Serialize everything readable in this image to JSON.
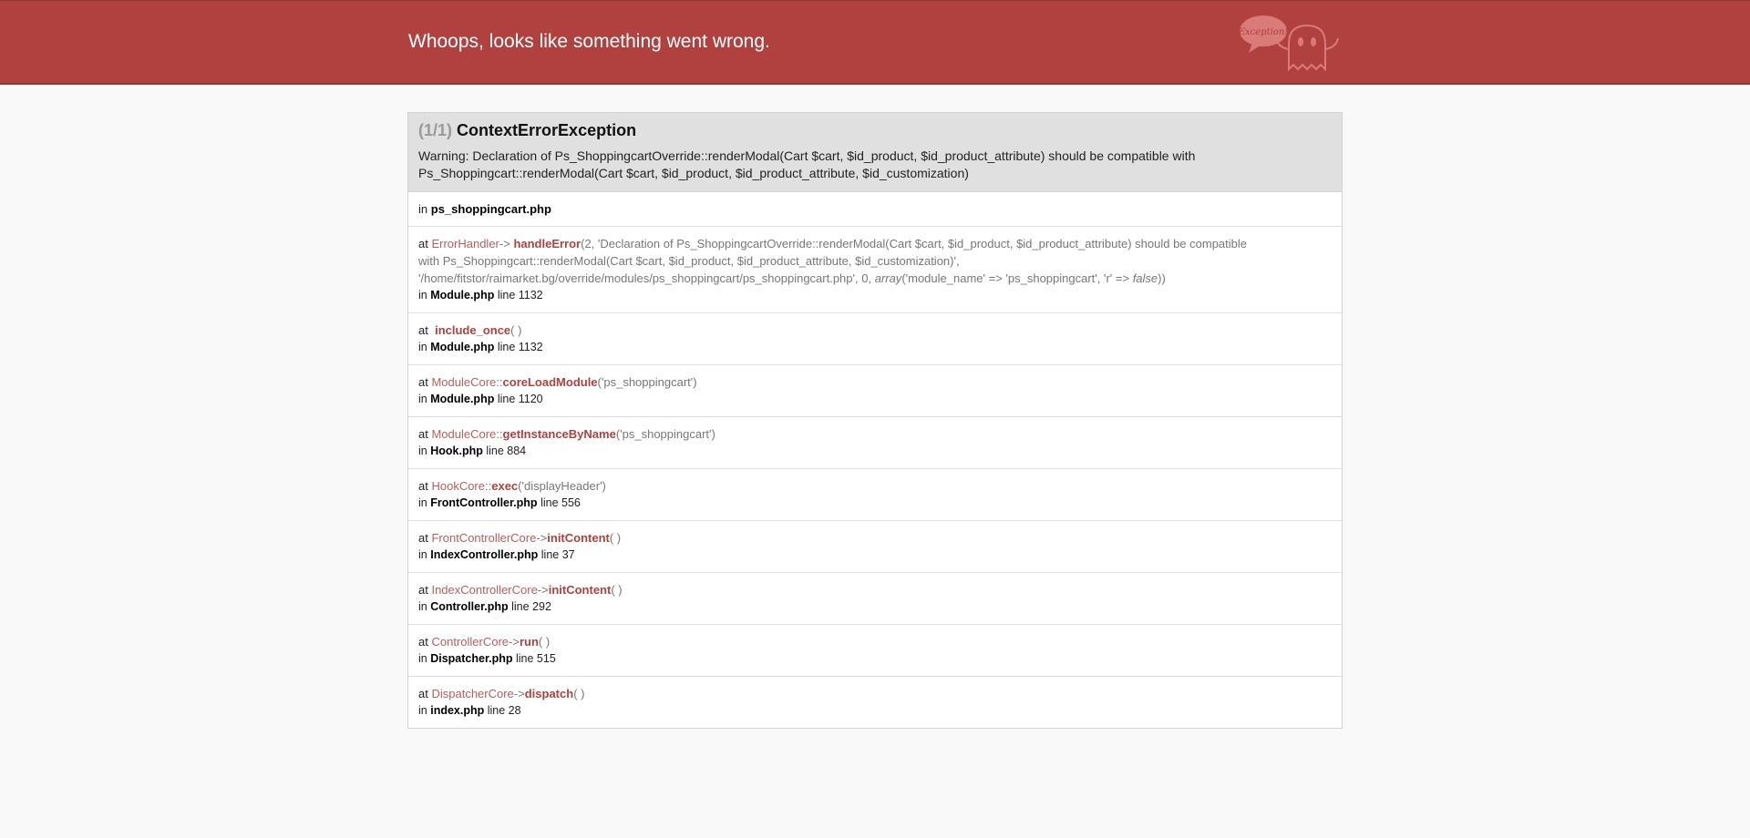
{
  "header": {
    "title": "Whoops, looks like something went wrong.",
    "logo_icon": "ghost-exception-icon",
    "logo_text": "Exception!"
  },
  "exception": {
    "count": "(1/1)",
    "name": "ContextErrorException",
    "message_line1": "Warning: Declaration of Ps_ShoppingcartOverride::renderModal(Cart $cart, $id_product, $id_product_attribute) should be compatible with",
    "message_line2": "Ps_Shoppingcart::renderModal(Cart $cart, $id_product, $id_product_attribute, $id_customization)"
  },
  "trace": {
    "first_file": "ps_shoppingcart.php",
    "frames": [
      {
        "class": "ErrorHandler",
        "sep": "->",
        "method": "handleError",
        "args_line1": "(2, 'Declaration of Ps_ShoppingcartOverride::renderModal(Cart $cart, $id_product, $id_product_attribute) should be compatible",
        "args_line2": "with Ps_Shoppingcart::renderModal(Cart $cart, $id_product, $id_product_attribute, $id_customization)',",
        "args_line3a": "'/home/fitstor/raimarket.bg/override/modules/ps_shoppingcart/ps_shoppingcart.php', 0, ",
        "args_line3_italic1": "array",
        "args_line3b": "('module_name' => 'ps_shoppingcart', 'r' => ",
        "args_line3_italic2": "false",
        "args_line3c": "))",
        "file": "Module.php",
        "line": "line 1132"
      },
      {
        "class": "",
        "sep": "",
        "method": "include_once",
        "args": "( )",
        "file": "Module.php",
        "line": "line 1132"
      },
      {
        "class": "ModuleCore",
        "sep": "::",
        "method": "coreLoadModule",
        "args": "('ps_shoppingcart')",
        "file": "Module.php",
        "line": "line 1120"
      },
      {
        "class": "ModuleCore",
        "sep": "::",
        "method": "getInstanceByName",
        "args": "('ps_shoppingcart')",
        "file": "Hook.php",
        "line": "line 884"
      },
      {
        "class": "HookCore",
        "sep": "::",
        "method": "exec",
        "args": "('displayHeader')",
        "file": "FrontController.php",
        "line": "line 556"
      },
      {
        "class": "FrontControllerCore",
        "sep": "->",
        "method": "initContent",
        "args": "( )",
        "file": "IndexController.php",
        "line": "line 37"
      },
      {
        "class": "IndexControllerCore",
        "sep": "->",
        "method": "initContent",
        "args": "( )",
        "file": "Controller.php",
        "line": "line 292"
      },
      {
        "class": "ControllerCore",
        "sep": "->",
        "method": "run",
        "args": "( )",
        "file": "Dispatcher.php",
        "line": "line 515"
      },
      {
        "class": "DispatcherCore",
        "sep": "->",
        "method": "dispatch",
        "args": "( )",
        "file": "index.php",
        "line": "line 28"
      }
    ],
    "at_label": "at",
    "in_label": "in"
  },
  "colors": {
    "header_bg": "#b0413e",
    "accent": "#b0413e",
    "exception_bg": "#e0e0e0"
  }
}
